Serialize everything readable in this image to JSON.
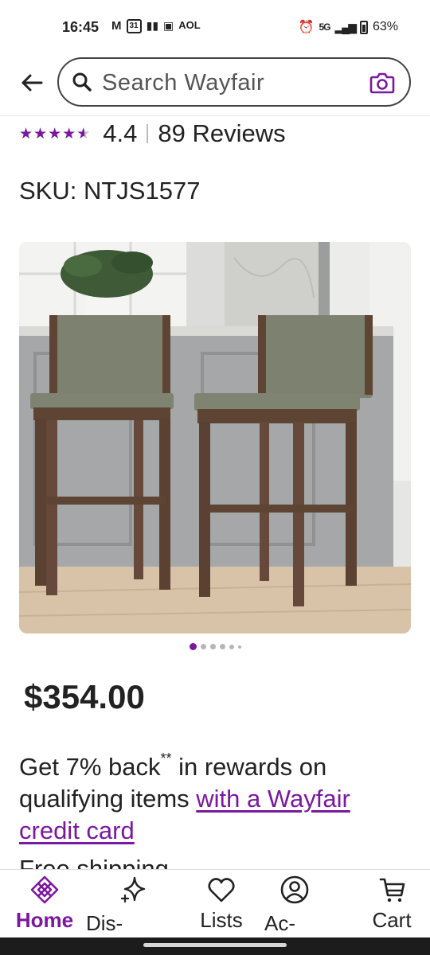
{
  "status_bar": {
    "time": "16:45",
    "left_icons": [
      "gmail-icon",
      "calendar-icon",
      "app-icon",
      "gallery-icon",
      "aol-icon"
    ],
    "calendar_day": "31",
    "aol_label": "AOL",
    "network": "5G",
    "battery": "63%"
  },
  "header": {
    "search_placeholder": "Search Wayfair",
    "back_icon": "arrow-left-icon",
    "search_icon": "search-icon",
    "camera_icon": "camera-icon"
  },
  "product": {
    "rating_value": "4.4",
    "rating_stars": 4.4,
    "review_count": "89 Reviews",
    "sku": "SKU: NTJS1577",
    "image_count": 6,
    "active_image": 1,
    "price": "$354.00",
    "rewards_text": "Get 7% back",
    "rewards_sup": "**",
    "rewards_text2": " in rewards on qualifying items ",
    "rewards_link": "with a Wayfair credit card",
    "shipping_text": "Free shipping"
  },
  "bottom_nav": {
    "items": [
      {
        "label": "Home",
        "icon": "home-icon",
        "active": true
      },
      {
        "label": "Dis-",
        "icon": "sparkle-icon",
        "active": false
      },
      {
        "label": "Lists",
        "icon": "heart-icon",
        "active": false
      },
      {
        "label": "Ac-",
        "icon": "account-icon",
        "active": false
      },
      {
        "label": "Cart",
        "icon": "cart-icon",
        "active": false
      }
    ]
  },
  "colors": {
    "accent": "#7b189f",
    "text": "#222222"
  }
}
